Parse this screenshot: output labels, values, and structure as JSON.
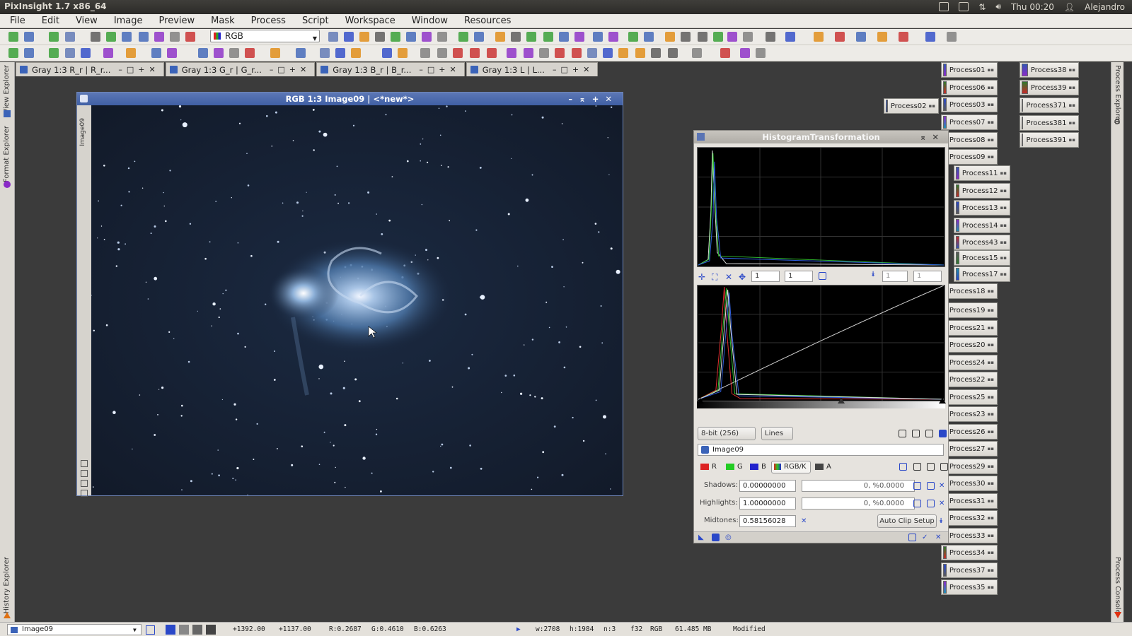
{
  "system_bar": {
    "app_title": "PixInsight 1.7 x86_64",
    "clock": "Thu 00:20",
    "user": "Alejandro"
  },
  "menu": [
    "File",
    "Edit",
    "View",
    "Image",
    "Preview",
    "Mask",
    "Process",
    "Script",
    "Workspace",
    "Window",
    "Resources"
  ],
  "toolbar": {
    "rgb_selector": "RGB"
  },
  "left_dock": {
    "view_explorer": "View Explorer",
    "format_explorer": "Format Explorer",
    "history_explorer": "History Explorer"
  },
  "right_dock": {
    "process_explorer": "Process Explorer",
    "process_console": "Process Console"
  },
  "tabs": [
    {
      "label": "Gray 1:3 R_r | R_r..."
    },
    {
      "label": "Gray 1:3 G_r | G_r..."
    },
    {
      "label": "Gray 1:3 B_r | B_r..."
    },
    {
      "label": "Gray 1:3 L | L..."
    }
  ],
  "image_window": {
    "title": "RGB 1:3 Image09 | <*new*>",
    "side_label": "Image09"
  },
  "histogram": {
    "title": "HistogramTransformation",
    "zoom_h": "1",
    "zoom_v": "1",
    "zoom_h2": "1",
    "zoom_v2": "1",
    "resolution": "8-bit (256)",
    "graph_style": "Lines",
    "view": "Image09",
    "channels": {
      "r": "R",
      "g": "G",
      "b": "B",
      "rgbk": "RGB/K",
      "a": "A"
    },
    "shadows_label": "Shadows:",
    "shadows_value": "0.00000000",
    "shadows_clip": "0, %0.0000",
    "highlights_label": "Highlights:",
    "highlights_value": "1.00000000",
    "highlights_clip": "0, %0.0000",
    "midtones_label": "Midtones:",
    "midtones_value": "0.58156028",
    "auto_clip": "Auto Clip Setup"
  },
  "process_icons": {
    "col1": [
      "Process01",
      "Process06",
      "Process03",
      "Process07",
      "Process08",
      "Process09"
    ],
    "col1b": [
      "Process11",
      "Process12",
      "Process13",
      "Process14",
      "Process43",
      "Process15",
      "Process17"
    ],
    "col1c": [
      "Process18",
      "Process19",
      "Process21",
      "Process20",
      "Process24",
      "Process22",
      "Process25",
      "Process23",
      "Process26",
      "Process27",
      "Process29",
      "Process30",
      "Process31",
      "Process32",
      "Process33",
      "Process34",
      "Process37",
      "Process35"
    ],
    "left": "Process02",
    "col2": [
      "Process38",
      "Process39",
      "Process371",
      "Process381",
      "Process391"
    ]
  },
  "status": {
    "view": "Image09",
    "x": "+1392.00",
    "y": "+1137.00",
    "r": "R:0.2687",
    "g": "G:0.4610",
    "b": "B:0.6263",
    "w": "w:2708",
    "h": "h:1984",
    "n": "n:3",
    "f": "f32",
    "mode": "RGB",
    "size": "61.485 MB",
    "state": "Modified"
  }
}
